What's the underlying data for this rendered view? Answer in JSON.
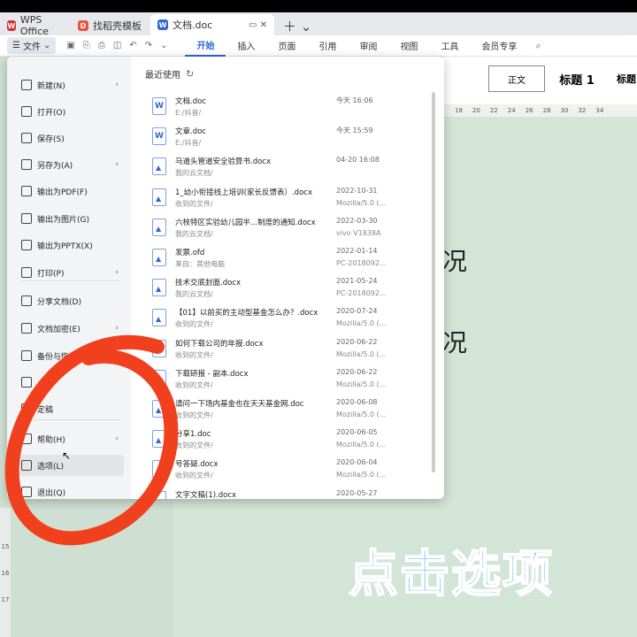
{
  "titlebar": {
    "tabs": [
      {
        "label": "WPS Office"
      },
      {
        "label": "找稻壳模板"
      },
      {
        "label": "文档.doc"
      }
    ]
  },
  "menubar": {
    "file_label": "文件",
    "tabs": [
      "开始",
      "插入",
      "页面",
      "引用",
      "审阅",
      "视图",
      "工具",
      "会员专享"
    ]
  },
  "ribbon": {
    "style_normal": "正文",
    "style_h1": "标题 1",
    "style_h2": "标题"
  },
  "file_menu": {
    "items": [
      {
        "label": "新建(N)",
        "icon": "new-doc-icon",
        "has_arrow": true
      },
      {
        "label": "打开(O)",
        "icon": "folder-icon",
        "has_arrow": false
      },
      {
        "label": "保存(S)",
        "icon": "save-icon",
        "has_arrow": false
      },
      {
        "label": "另存为(A)",
        "icon": "save-as-icon",
        "has_arrow": true
      },
      {
        "label": "输出为PDF(F)",
        "icon": "pdf-icon",
        "has_arrow": false
      },
      {
        "label": "输出为图片(G)",
        "icon": "image-icon",
        "has_arrow": false
      },
      {
        "label": "输出为PPTX(X)",
        "icon": "pptx-icon",
        "has_arrow": false
      },
      {
        "label": "打印(P)",
        "icon": "print-icon",
        "has_arrow": true
      },
      {
        "label": "分享文档(D)",
        "icon": "share-icon",
        "has_arrow": false
      },
      {
        "label": "文档加密(E)",
        "icon": "lock-icon",
        "has_arrow": true
      },
      {
        "label": "备份与恢复(K)",
        "icon": "backup-icon",
        "has_arrow": true
      },
      {
        "label": "",
        "icon": "doc-icon",
        "has_arrow": false
      },
      {
        "label": "定稿",
        "icon": "finalize-icon",
        "has_arrow": false
      },
      {
        "label": "帮助(H)",
        "icon": "help-icon",
        "has_arrow": true
      },
      {
        "label": "选项(L)",
        "icon": "gear-icon",
        "has_arrow": false
      },
      {
        "label": "退出(Q)",
        "icon": "exit-icon",
        "has_arrow": false
      }
    ]
  },
  "recent": {
    "heading": "最近使用",
    "files": [
      {
        "name": "文档.doc",
        "path": "E:/抖音/",
        "date": "今天  16:06",
        "source": "",
        "type": "doc"
      },
      {
        "name": "文章.doc",
        "path": "E:/抖音/",
        "date": "今天  15:59",
        "source": "",
        "type": "doc"
      },
      {
        "name": "马道头管道安全验算书.docx",
        "path": "我的云文档/",
        "date": "04-20 16:08",
        "source": "",
        "type": "pic"
      },
      {
        "name": "1_幼小衔接线上培训(家长反馈表）.docx",
        "path": "收到的文件/",
        "date": "2022-10-31",
        "source": "Mozilla/5.0 (...",
        "type": "pic"
      },
      {
        "name": "六枝特区实验幼儿园半...制度的通知.docx",
        "path": "我的云文档/",
        "date": "2022-03-30",
        "source": "vivo V1838A",
        "type": "pic"
      },
      {
        "name": "发票.ofd",
        "path": "来自：其他电脑",
        "date": "2022-01-14",
        "source": "PC-2018092...",
        "type": "pic"
      },
      {
        "name": "技术交底封面.docx",
        "path": "我的云文档/",
        "date": "2021-05-24",
        "source": "PC-2018092...",
        "type": "pic"
      },
      {
        "name": "【01】以前买的主动型基金怎么办？.docx",
        "path": "收到的文件/",
        "date": "2020-07-24",
        "source": "Mozilla/5.0 (...",
        "type": "pic"
      },
      {
        "name": "如何下载公司的年报.docx",
        "path": "收到的文件/",
        "date": "2020-06-22",
        "source": "Mozilla/5.0 (...",
        "type": "pic"
      },
      {
        "name": "下载研报 - 副本.docx",
        "path": "收到的文件/",
        "date": "2020-06-22",
        "source": "Mozilla/5.0 (...",
        "type": "pic"
      },
      {
        "name": "请问一下场内基金也在天天基金网.doc",
        "path": "收到的文件/",
        "date": "2020-06-08",
        "source": "Mozilla/5.0 (...",
        "type": "pic"
      },
      {
        "name": "分享1.doc",
        "path": "收到的文件/",
        "date": "2020-06-05",
        "source": "Mozilla/5.0 (...",
        "type": "pic"
      },
      {
        "name": "号答疑.docx",
        "path": "收到的文件/",
        "date": "2020-06-04",
        "source": "Mozilla/5.0 (...",
        "type": "pic"
      },
      {
        "name": "文字文稿(1).docx",
        "path": "",
        "date": "2020-05-27",
        "source": "",
        "type": "pic"
      }
    ]
  },
  "document": {
    "line1": "况",
    "line2": "况"
  },
  "caption": "点击选项",
  "colors": {
    "accent": "#2f66d6",
    "annotation_red": "#f0401e",
    "caption_blue": "#4aa8f0"
  }
}
